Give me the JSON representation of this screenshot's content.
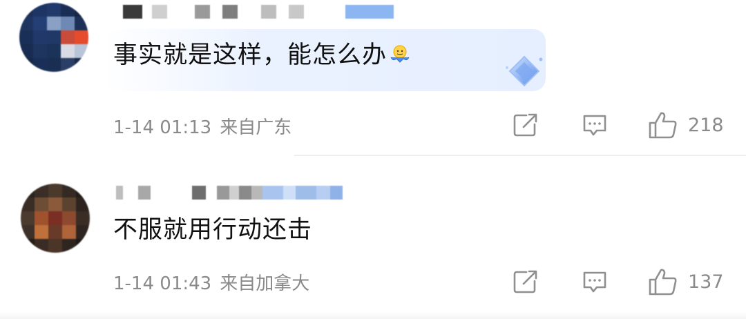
{
  "comments": [
    {
      "text": "事实就是这样，能怎么办",
      "emoji_icon": "shrug-emoji",
      "badge_icon": "diamond-badge-icon",
      "date": "1-14 01:13",
      "location": "来自广东",
      "likes": "218"
    },
    {
      "text": "不服就用行动还击",
      "date": "1-14 01:43",
      "location": "来自加拿大",
      "likes": "137"
    }
  ],
  "colors": {
    "meta_text": "#8a8a8a",
    "icon_stroke": "#8f8f8f",
    "bubble_accent": "#e6efff"
  }
}
